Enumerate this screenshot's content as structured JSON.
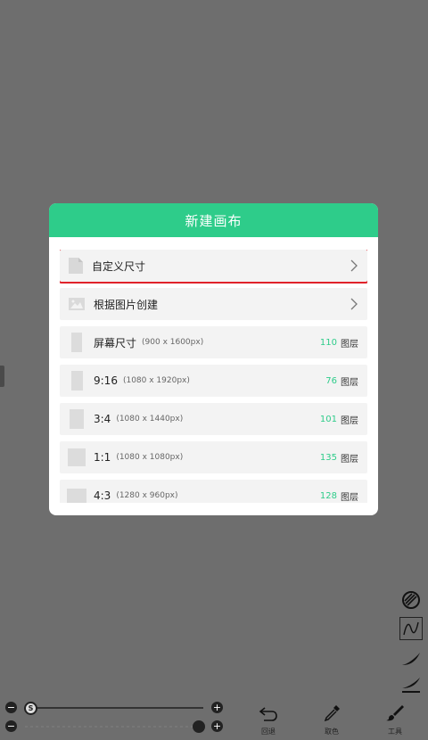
{
  "dialog": {
    "title": "新建画布",
    "options": [
      {
        "label": "自定义尺寸"
      },
      {
        "label": "根据图片创建"
      }
    ],
    "presets": [
      {
        "label": "屏幕尺寸",
        "dims": "(900 x 1600px)",
        "layers": "110",
        "layers_unit": "图层"
      },
      {
        "label": "9:16",
        "dims": "(1080 x 1920px)",
        "layers": "76",
        "layers_unit": "图层"
      },
      {
        "label": "3:4",
        "dims": "(1080 x 1440px)",
        "layers": "101",
        "layers_unit": "图层"
      },
      {
        "label": "1:1",
        "dims": "(1080 x 1080px)",
        "layers": "135",
        "layers_unit": "图层"
      },
      {
        "label": "4:3",
        "dims": "(1280 x 960px)",
        "layers": "128",
        "layers_unit": "图层"
      }
    ]
  },
  "bottom": {
    "size_knob_letter": "S",
    "undo_label": "回退",
    "picker_label": "取色",
    "tools_label": "工具"
  },
  "colors": {
    "accent": "#2ecc8a",
    "highlight": "#e0222a",
    "backdrop": "#6e6e6e"
  }
}
